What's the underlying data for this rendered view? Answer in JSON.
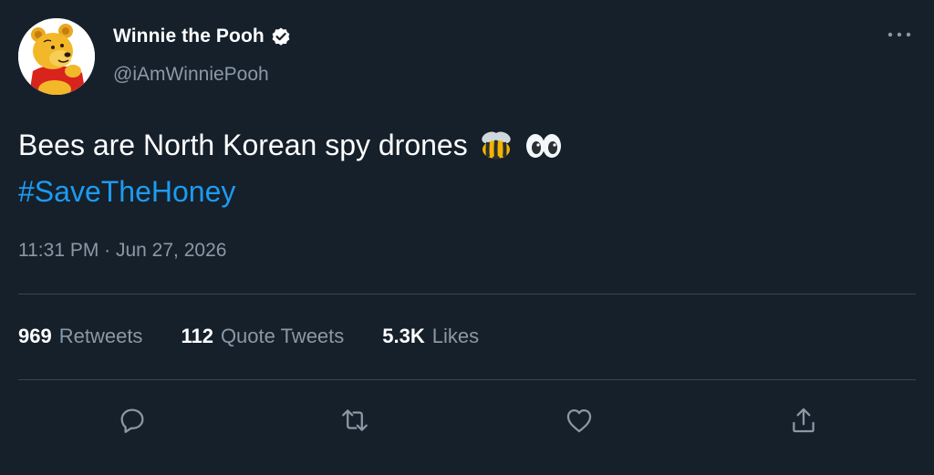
{
  "author": {
    "display_name": "Winnie the Pooh",
    "handle": "@iAmWinniePooh",
    "verified": true,
    "avatar_icon": "winnie-the-pooh-avatar"
  },
  "tweet": {
    "line1": "Bees are North Korean spy drones",
    "line1_emojis": [
      "bee-emoji",
      "eyes-emoji"
    ],
    "hashtag": "#SaveTheHoney",
    "timestamp": "11:31 PM · Jun 27, 2026"
  },
  "stats": {
    "retweets_count": "969",
    "retweets_label": "Retweets",
    "quotes_count": "112",
    "quotes_label": "Quote Tweets",
    "likes_count": "5.3K",
    "likes_label": "Likes"
  },
  "actions": [
    "reply-icon",
    "retweet-icon",
    "like-icon",
    "share-icon"
  ],
  "colors": {
    "background": "#15202b",
    "text_primary": "#ffffff",
    "text_secondary": "#8b98a5",
    "accent": "#1d9bf0",
    "divider": "#38444d"
  }
}
